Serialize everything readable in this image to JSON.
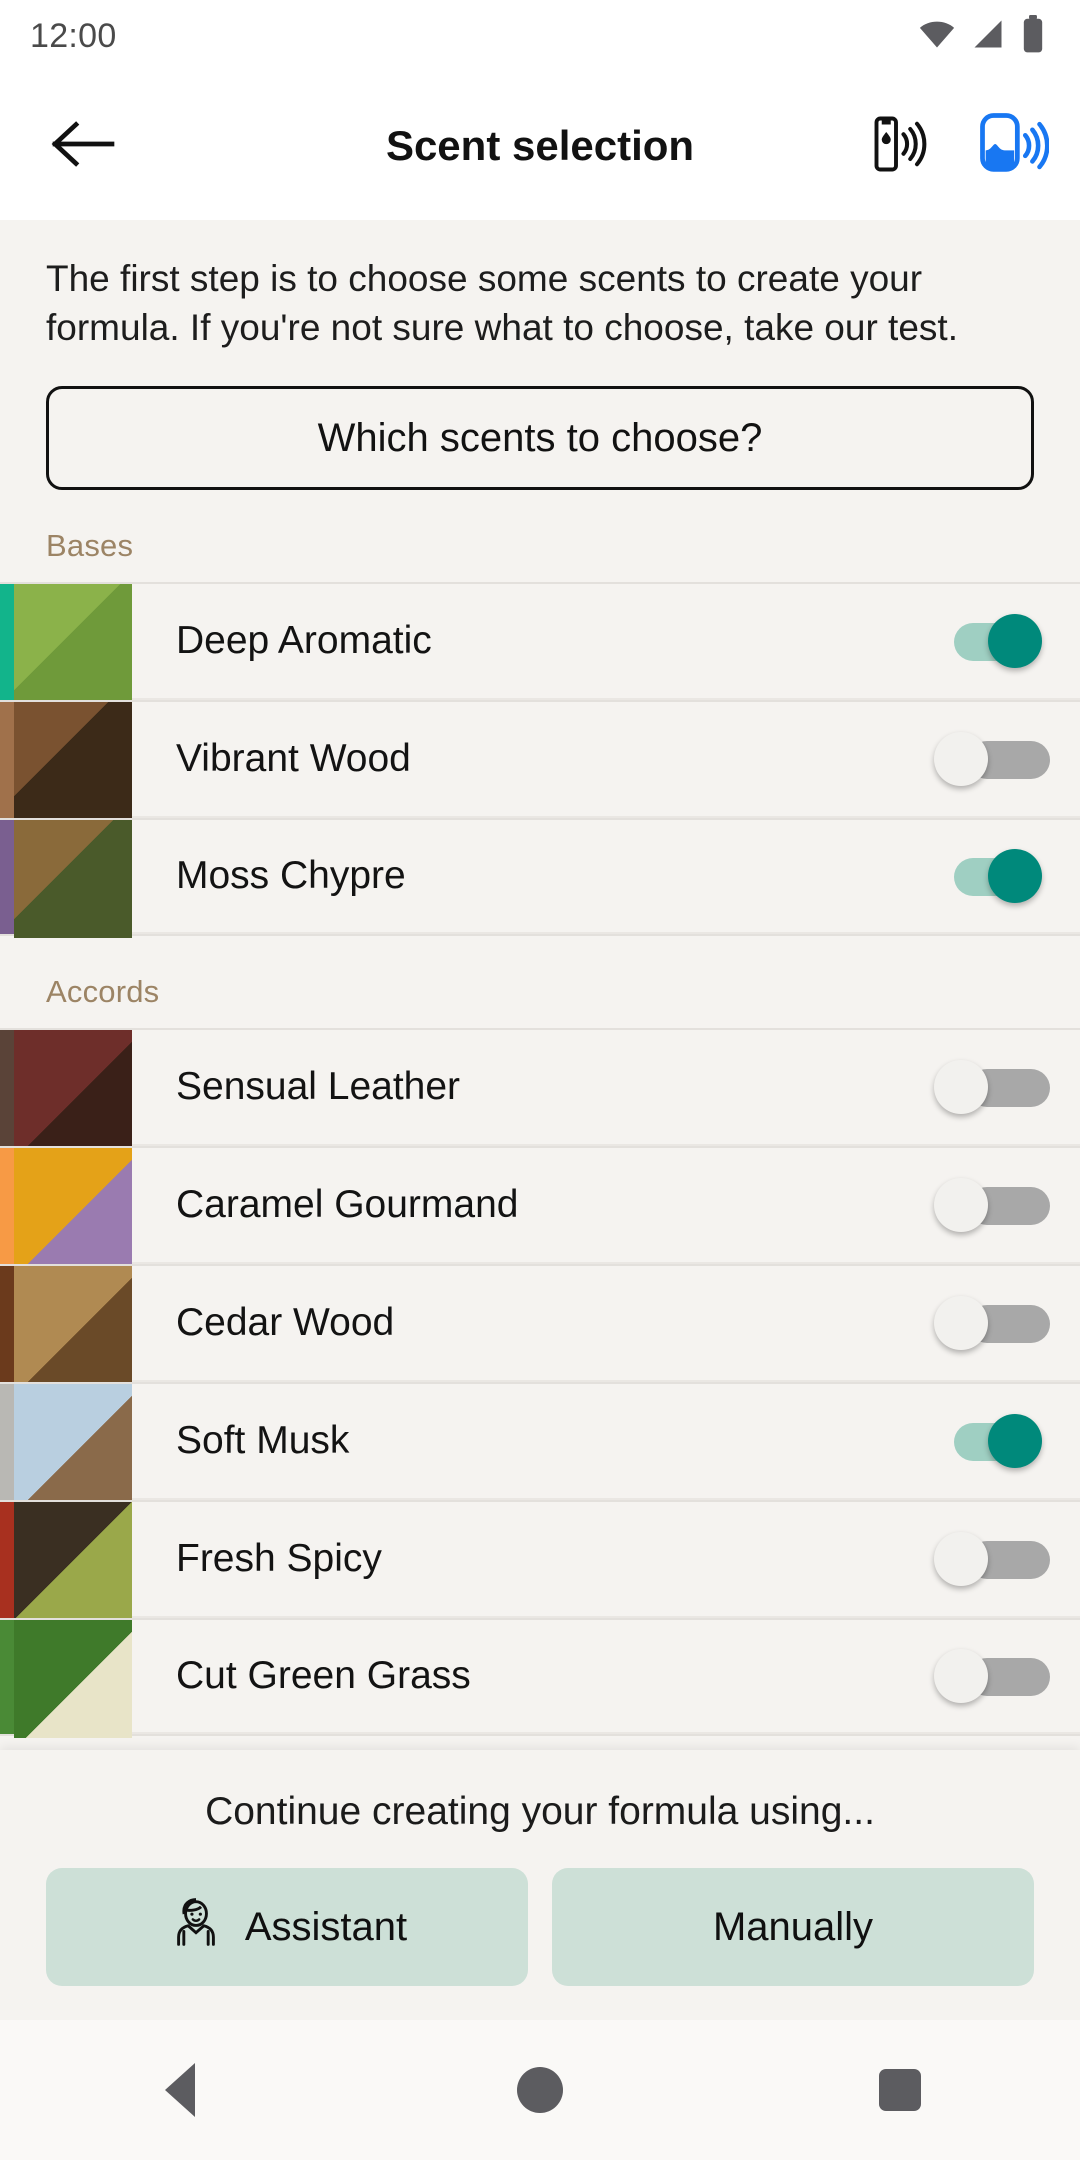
{
  "statusbar": {
    "time": "12:00",
    "icons": [
      "wifi-icon",
      "cellular-signal-icon",
      "battery-icon"
    ]
  },
  "appbar": {
    "back_icon": "arrow-left-icon",
    "title": "Scent selection",
    "actions": [
      {
        "icon": "cartridge-connected-icon",
        "color": "#111111"
      },
      {
        "icon": "diffuser-connected-icon",
        "color": "#1877f2"
      }
    ]
  },
  "main": {
    "intro": "The first step is to choose some scents to create your formula. If you're not sure what to choose, take our test.",
    "cta_label": "Which scents to choose?",
    "sections": [
      {
        "title": "Bases",
        "items": [
          {
            "label": "Deep Aromatic",
            "accent": "#12b48b",
            "enabled": true,
            "thumb": "herbs-lavender-wood-thumb"
          },
          {
            "label": "Vibrant Wood",
            "accent": "#a0714b",
            "enabled": false,
            "thumb": "wood-lime-pepper-thumb"
          },
          {
            "label": "Moss Chypre",
            "accent": "#7a5f90",
            "enabled": true,
            "thumb": "moss-roots-thumb"
          }
        ]
      },
      {
        "title": "Accords",
        "items": [
          {
            "label": "Sensual Leather",
            "accent": "#5a4338",
            "enabled": false,
            "thumb": "leather-thumb"
          },
          {
            "label": "Caramel Gourmand",
            "accent": "#f79a45",
            "enabled": false,
            "thumb": "caramel-golden-thumb"
          },
          {
            "label": "Cedar Wood",
            "accent": "#6b3a1c",
            "enabled": false,
            "thumb": "cedar-logs-thumb"
          },
          {
            "label": "Soft Musk",
            "accent": "#b9b8b4",
            "enabled": true,
            "thumb": "ice-berries-thumb"
          },
          {
            "label": "Fresh Spicy",
            "accent": "#a8301f",
            "enabled": false,
            "thumb": "peppercorn-cardamom-thumb"
          },
          {
            "label": "Cut Green Grass",
            "accent": "#4a8a36",
            "enabled": false,
            "thumb": "green-grass-thumb"
          }
        ]
      }
    ]
  },
  "bottomsheet": {
    "title": "Continue creating your formula using...",
    "assistant_label": "Assistant",
    "assistant_icon": "assistant-avatar-icon",
    "manually_label": "Manually"
  },
  "navbar": {
    "back": "nav-back-icon",
    "home": "nav-home-icon",
    "recents": "nav-recents-icon"
  },
  "colors": {
    "accent_teal": "#00897b",
    "track_on": "#9fcfc2",
    "section_header": "#9c8465",
    "button_bg": "#cde0d7",
    "background": "#f5f3f0"
  }
}
